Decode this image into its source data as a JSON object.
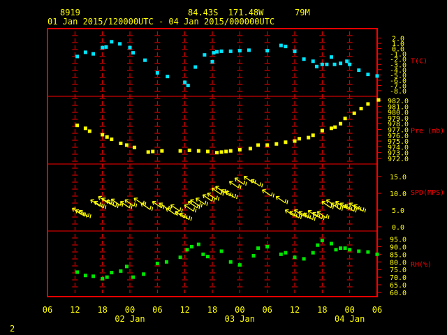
{
  "header": {
    "station_id": "8919",
    "location": "84.43S  171.48W",
    "elevation": "79M",
    "time_range": "01 Jan 2015/120000UTC - 04 Jan 2015/000000UTC"
  },
  "footer": {
    "page_number": "2"
  },
  "colors": {
    "frame": "#ff0000",
    "ticks": "#ff0000",
    "labels": "#ffff00",
    "temp": "#00e5ff",
    "pressure": "#ffff00",
    "wind": "#ffff00",
    "rh": "#00e600",
    "background": "#000000"
  },
  "chart_data": {
    "type": "scatter",
    "x_axis": {
      "ticks": [
        "06",
        "12",
        "18",
        "00",
        "06",
        "12",
        "18",
        "00",
        "06",
        "12",
        "18",
        "00",
        "06"
      ],
      "day_labels": [
        {
          "text": "02 Jan",
          "at_tick": 3
        },
        {
          "text": "03 Jan",
          "at_tick": 7
        },
        {
          "text": "04 Jan",
          "at_tick": 11
        }
      ],
      "x_range_hours": [
        0,
        72
      ],
      "x_unit": "hours since 01 Jan 2015 06UTC"
    },
    "panels": [
      {
        "name": "T(C)",
        "marker": "square",
        "color": "temp",
        "ylim": [
          -8.0,
          3.0
        ],
        "y_ticks": [
          "2.0",
          "1.0",
          "0.0",
          "-1.0",
          "-2.0",
          "-3.0",
          "-4.0",
          "-5.0",
          "-6.0",
          "-7.0",
          "-8.0"
        ],
        "y_tick_values": [
          2,
          1,
          0,
          -1,
          -2,
          -3,
          -4,
          -5,
          -6,
          -7,
          -8
        ],
        "x": [
          6.5,
          8.3,
          10.0,
          12.0,
          12.8,
          14.0,
          15.8,
          18.0,
          18.7,
          21.3,
          24.0,
          26.2,
          30.0,
          30.7,
          32.3,
          34.3,
          36.0,
          36.3,
          37.0,
          38.0,
          40.0,
          42.0,
          44.0,
          48.0,
          51.0,
          52.0,
          54.0,
          56.0,
          58.0,
          58.8,
          60.0,
          61.0,
          62.0,
          62.7,
          64.0,
          65.4,
          66.0,
          68.0,
          70.0,
          72.0
        ],
        "y": [
          -1.5,
          -0.7,
          -1.0,
          0.2,
          0.3,
          1.3,
          0.9,
          0.2,
          -0.8,
          -2.2,
          -4.6,
          -5.3,
          -6.4,
          -7.0,
          -3.5,
          -1.2,
          -2.5,
          -0.8,
          -0.6,
          -0.5,
          -0.5,
          -0.4,
          -0.3,
          -0.4,
          0.6,
          0.4,
          -0.5,
          -2.0,
          -2.4,
          -3.4,
          -3.0,
          -3.0,
          -1.6,
          -3.0,
          -2.8,
          -2.4,
          -3.0,
          -4.1,
          -4.9,
          -5.2
        ]
      },
      {
        "name": "Pre (mb)",
        "marker": "square",
        "color": "pressure",
        "ylim": [
          972.0,
          982.0
        ],
        "y_ticks": [
          "982.0",
          "981.0",
          "980.0",
          "979.0",
          "978.0",
          "977.0",
          "976.0",
          "975.0",
          "974.0",
          "973.0",
          "972.0"
        ],
        "y_tick_values": [
          982,
          981,
          980,
          979,
          978,
          977,
          976,
          975,
          974,
          973,
          972
        ],
        "x": [
          6.5,
          8.3,
          9.2,
          12.0,
          13.0,
          14.0,
          16.0,
          17.3,
          19.0,
          22.0,
          23.0,
          25.0,
          29.0,
          31.0,
          33.0,
          35.0,
          37.0,
          38.0,
          39.0,
          40.0,
          42.0,
          44.3,
          46.0,
          48.0,
          50.0,
          52.0,
          54.0,
          55.0,
          57.0,
          58.0,
          60.0,
          62.0,
          62.8,
          64.0,
          65.0,
          67.0,
          68.5,
          70.0,
          72.3
        ],
        "y": [
          977.7,
          977.2,
          976.7,
          976.1,
          975.7,
          975.3,
          974.6,
          974.3,
          973.9,
          973.1,
          973.2,
          973.3,
          973.3,
          973.4,
          973.3,
          973.2,
          973.0,
          973.1,
          973.2,
          973.3,
          973.5,
          973.7,
          974.3,
          974.3,
          974.5,
          974.8,
          975.0,
          975.4,
          975.6,
          976.0,
          976.8,
          977.2,
          977.4,
          978.0,
          978.9,
          979.8,
          980.6,
          981.4,
          982.1
        ]
      },
      {
        "name": "SPD(MPS)",
        "marker": "wind-arrow",
        "color": "wind",
        "ylim": [
          0.0,
          17.5
        ],
        "y_ticks": [
          "15.0",
          "10.0",
          "5.0",
          "0.0"
        ],
        "y_tick_values": [
          15,
          10,
          5,
          0
        ],
        "x": [
          6.5,
          7.2,
          8.0,
          10.5,
          11.3,
          12.2,
          13.0,
          14.0,
          15.0,
          17.0,
          18.0,
          20.0,
          21.5,
          24.0,
          25.5,
          27.0,
          28.0,
          29.0,
          30.0,
          31.0,
          31.8,
          32.3,
          33.5,
          35.0,
          36.0,
          37.0,
          37.8,
          39.0,
          40.0,
          40.8,
          42.0,
          44.0,
          45.5,
          48.0,
          51.0,
          53.0,
          54.0,
          55.0,
          56.0,
          57.0,
          58.0,
          59.0,
          60.0,
          61.0,
          62.0,
          63.0,
          64.0,
          65.0,
          66.0,
          67.0,
          68.0
        ],
        "y": [
          4.5,
          4.0,
          3.8,
          7.0,
          6.5,
          8.0,
          7.5,
          6.8,
          7.2,
          6.5,
          7.0,
          7.5,
          6.0,
          6.5,
          6.0,
          4.5,
          5.5,
          3.5,
          3.0,
          5.5,
          6.5,
          7.0,
          7.5,
          8.5,
          9.0,
          10.5,
          11.0,
          10.0,
          9.5,
          12.5,
          13.5,
          14.0,
          13.0,
          10.0,
          8.0,
          4.0,
          3.5,
          4.0,
          3.5,
          3.0,
          3.8,
          3.2,
          3.5,
          6.5,
          7.0,
          6.0,
          6.5,
          6.0,
          5.5,
          6.0,
          5.5
        ],
        "direction_note": "arrows point toward upper-left with barbs"
      },
      {
        "name": "RH(%)",
        "marker": "square",
        "color": "rh",
        "ylim": [
          60.0,
          97.5
        ],
        "y_ticks": [
          "95.0",
          "90.0",
          "85.0",
          "80.0",
          "75.0",
          "70.0",
          "65.0",
          "60.0"
        ],
        "y_tick_values": [
          95,
          90,
          85,
          80,
          75,
          70,
          65,
          60
        ],
        "x": [
          6.5,
          8.3,
          10.0,
          12.0,
          13.0,
          14.0,
          16.0,
          17.3,
          18.7,
          21.0,
          24.0,
          26.0,
          29.0,
          30.5,
          31.5,
          33.0,
          34.0,
          35.0,
          38.0,
          40.0,
          42.0,
          45.0,
          46.0,
          48.0,
          51.0,
          52.0,
          54.0,
          56.0,
          58.0,
          59.0,
          60.0,
          62.0,
          63.0,
          64.0,
          65.0,
          66.0,
          68.0,
          70.0,
          72.0
        ],
        "y": [
          73.3,
          71.1,
          70.6,
          69.0,
          70.0,
          73.0,
          74.0,
          77.0,
          70.0,
          72.0,
          79.0,
          80.0,
          83.0,
          88.0,
          90.0,
          91.5,
          85.0,
          83.5,
          87.0,
          80.0,
          78.0,
          84.0,
          89.0,
          90.0,
          85.0,
          86.0,
          83.0,
          82.0,
          86.0,
          91.0,
          94.0,
          92.0,
          88.0,
          89.0,
          89.0,
          88.0,
          87.0,
          86.5,
          85.0
        ]
      }
    ]
  }
}
